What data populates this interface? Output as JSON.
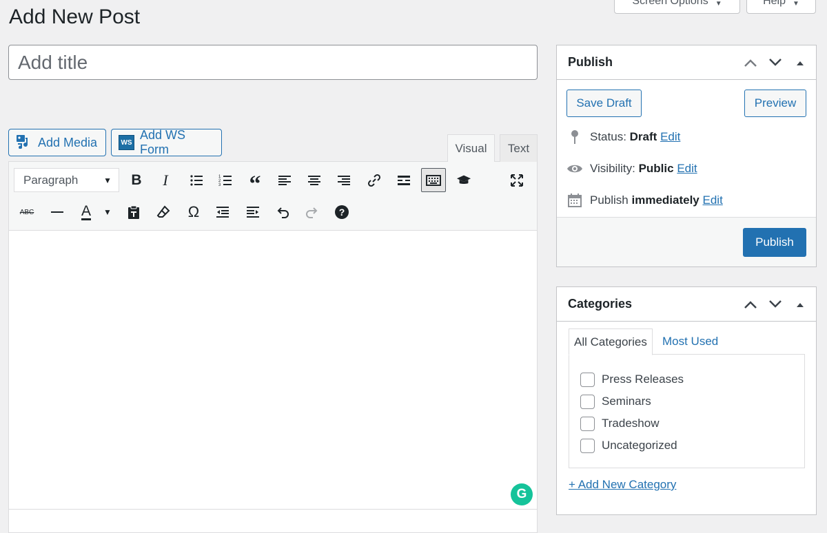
{
  "page": {
    "title": "Add New Post"
  },
  "screen_meta": {
    "screen_options": "Screen Options",
    "help": "Help"
  },
  "post_title": {
    "placeholder": "Add title",
    "value": ""
  },
  "media_buttons": {
    "add_media": "Add Media",
    "add_ws_form": "Add WS Form",
    "ws_logo": "WS"
  },
  "editor_tabs": {
    "visual": "Visual",
    "text": "Text",
    "active": "Visual"
  },
  "toolbar": {
    "format_select": "Paragraph",
    "row1": [
      "bold-icon",
      "italic-icon",
      "bulleted-list-icon",
      "numbered-list-icon",
      "blockquote-icon",
      "align-left-icon",
      "align-center-icon",
      "align-right-icon",
      "link-icon",
      "read-more-icon",
      "toolbar-toggle-icon",
      "graduation-cap-icon",
      "fullscreen-icon"
    ],
    "row2": [
      "strikethrough-icon",
      "horizontal-line-icon",
      "text-color-icon",
      "paste-as-text-icon",
      "clear-formatting-icon",
      "special-character-icon",
      "outdent-icon",
      "indent-icon",
      "undo-icon",
      "redo-icon",
      "help-icon"
    ],
    "strikethrough_text": "ABC",
    "text_color_letter": "A",
    "omega": "Ω",
    "help_glyph": "?"
  },
  "grammarly": {
    "letter": "G",
    "color": "#15c39a"
  },
  "publish_box": {
    "title": "Publish",
    "save_draft": "Save Draft",
    "preview": "Preview",
    "status_label": "Status:",
    "status_value": "Draft",
    "visibility_label": "Visibility:",
    "visibility_value": "Public",
    "publish_label": "Publish",
    "publish_value": "immediately",
    "edit": "Edit",
    "publish_button": "Publish"
  },
  "categories_box": {
    "title": "Categories",
    "tab_all": "All Categories",
    "tab_most_used": "Most Used",
    "items": [
      {
        "label": "Press Releases",
        "checked": false
      },
      {
        "label": "Seminars",
        "checked": false
      },
      {
        "label": "Tradeshow",
        "checked": false
      },
      {
        "label": "Uncategorized",
        "checked": false
      }
    ],
    "add_new": "+ Add New Category"
  },
  "colors": {
    "accent": "#2271b1",
    "background": "#f0f0f1",
    "border": "#c3c4c7"
  }
}
